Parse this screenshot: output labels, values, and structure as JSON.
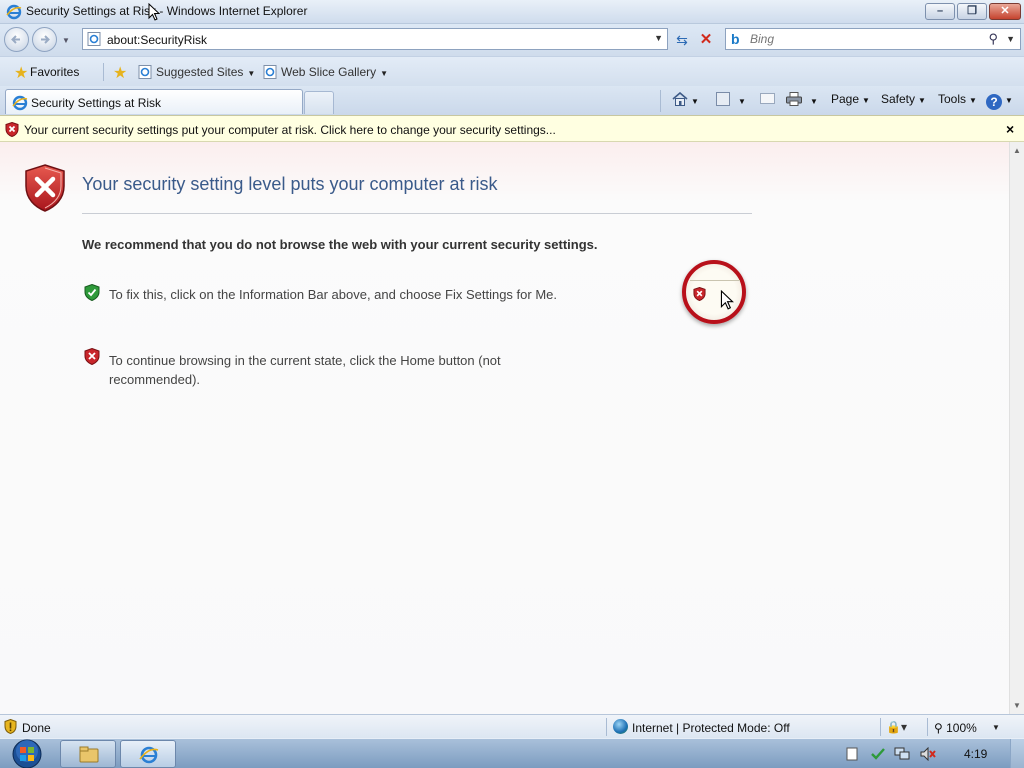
{
  "window": {
    "title": "Security Settings at Risk - Windows Internet Explorer"
  },
  "address": {
    "url": "about:SecurityRisk"
  },
  "search": {
    "placeholder": "Bing"
  },
  "favorites_bar": {
    "favorites_label": "Favorites",
    "suggested_sites_label": "Suggested Sites",
    "web_slice_gallery_label": "Web Slice Gallery"
  },
  "tab": {
    "label": "Security Settings at Risk"
  },
  "command_bar": {
    "page_label": "Page",
    "safety_label": "Safety",
    "tools_label": "Tools"
  },
  "info_bar": {
    "message": "Your current security settings put your computer at risk. Click here to change your security settings...",
    "close_glyph": "×"
  },
  "content": {
    "heading": "Your security setting level puts your computer at risk",
    "recommendation": "We recommend that you do not browse the web with your current security settings.",
    "fix_instruction": "To fix this, click on the Information Bar above, and choose Fix Settings for Me.",
    "continue_instruction": "To continue browsing in the current state, click the Home button (not recommended)."
  },
  "status_bar": {
    "status": "Done",
    "zone": "Internet | Protected Mode: Off",
    "zoom": "100%"
  },
  "taskbar": {
    "clock": "4:19"
  },
  "colors": {
    "heading_blue": "#3a5a8a",
    "info_bar_bg": "#ffffe1",
    "highlight_ring": "#b8101a",
    "shield_red": "#c8262b",
    "shield_green": "#2e9a3a"
  },
  "icons": {
    "back": "back-arrow-icon",
    "forward": "forward-arrow-icon",
    "refresh": "refresh-icon",
    "stop": "stop-icon",
    "search": "magnifier-icon",
    "home": "home-icon",
    "feeds": "rss-feed-icon",
    "mail": "mail-icon",
    "print": "printer-icon",
    "help": "help-icon",
    "security_warning": "red-shield-x-icon",
    "safe": "green-shield-check-icon"
  }
}
